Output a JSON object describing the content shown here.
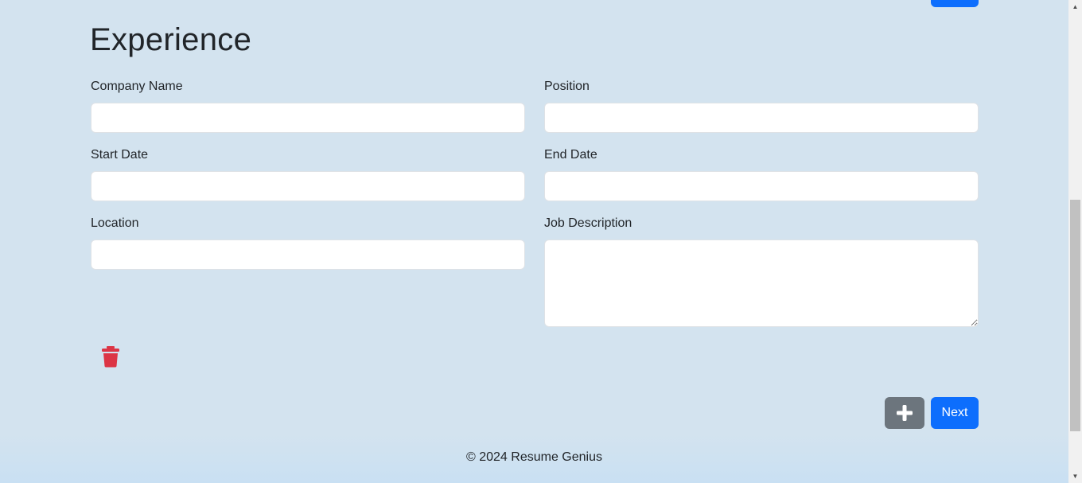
{
  "section": {
    "title": "Experience"
  },
  "fields": {
    "company_name": {
      "label": "Company Name",
      "value": ""
    },
    "position": {
      "label": "Position",
      "value": ""
    },
    "start_date": {
      "label": "Start Date",
      "value": ""
    },
    "end_date": {
      "label": "End Date",
      "value": ""
    },
    "location": {
      "label": "Location",
      "value": ""
    },
    "job_description": {
      "label": "Job Description",
      "value": ""
    }
  },
  "actions": {
    "next_label": "Next",
    "add_icon": "plus-icon",
    "delete_icon": "trash-icon"
  },
  "footer": {
    "text": "© 2024 Resume Genius"
  },
  "colors": {
    "primary": "#0d6efd",
    "secondary": "#6c757d",
    "danger": "#dc3545",
    "background": "#d3e3ef"
  }
}
